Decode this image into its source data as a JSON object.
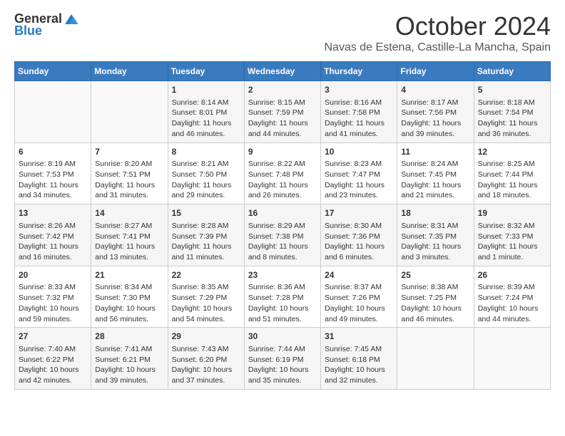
{
  "header": {
    "logo_general": "General",
    "logo_blue": "Blue",
    "month_title": "October 2024",
    "location": "Navas de Estena, Castille-La Mancha, Spain"
  },
  "calendar": {
    "days_of_week": [
      "Sunday",
      "Monday",
      "Tuesday",
      "Wednesday",
      "Thursday",
      "Friday",
      "Saturday"
    ],
    "weeks": [
      [
        {
          "day": "",
          "info": ""
        },
        {
          "day": "",
          "info": ""
        },
        {
          "day": "1",
          "info": "Sunrise: 8:14 AM\nSunset: 8:01 PM\nDaylight: 11 hours and 46 minutes."
        },
        {
          "day": "2",
          "info": "Sunrise: 8:15 AM\nSunset: 7:59 PM\nDaylight: 11 hours and 44 minutes."
        },
        {
          "day": "3",
          "info": "Sunrise: 8:16 AM\nSunset: 7:58 PM\nDaylight: 11 hours and 41 minutes."
        },
        {
          "day": "4",
          "info": "Sunrise: 8:17 AM\nSunset: 7:56 PM\nDaylight: 11 hours and 39 minutes."
        },
        {
          "day": "5",
          "info": "Sunrise: 8:18 AM\nSunset: 7:54 PM\nDaylight: 11 hours and 36 minutes."
        }
      ],
      [
        {
          "day": "6",
          "info": "Sunrise: 8:19 AM\nSunset: 7:53 PM\nDaylight: 11 hours and 34 minutes."
        },
        {
          "day": "7",
          "info": "Sunrise: 8:20 AM\nSunset: 7:51 PM\nDaylight: 11 hours and 31 minutes."
        },
        {
          "day": "8",
          "info": "Sunrise: 8:21 AM\nSunset: 7:50 PM\nDaylight: 11 hours and 29 minutes."
        },
        {
          "day": "9",
          "info": "Sunrise: 8:22 AM\nSunset: 7:48 PM\nDaylight: 11 hours and 26 minutes."
        },
        {
          "day": "10",
          "info": "Sunrise: 8:23 AM\nSunset: 7:47 PM\nDaylight: 11 hours and 23 minutes."
        },
        {
          "day": "11",
          "info": "Sunrise: 8:24 AM\nSunset: 7:45 PM\nDaylight: 11 hours and 21 minutes."
        },
        {
          "day": "12",
          "info": "Sunrise: 8:25 AM\nSunset: 7:44 PM\nDaylight: 11 hours and 18 minutes."
        }
      ],
      [
        {
          "day": "13",
          "info": "Sunrise: 8:26 AM\nSunset: 7:42 PM\nDaylight: 11 hours and 16 minutes."
        },
        {
          "day": "14",
          "info": "Sunrise: 8:27 AM\nSunset: 7:41 PM\nDaylight: 11 hours and 13 minutes."
        },
        {
          "day": "15",
          "info": "Sunrise: 8:28 AM\nSunset: 7:39 PM\nDaylight: 11 hours and 11 minutes."
        },
        {
          "day": "16",
          "info": "Sunrise: 8:29 AM\nSunset: 7:38 PM\nDaylight: 11 hours and 8 minutes."
        },
        {
          "day": "17",
          "info": "Sunrise: 8:30 AM\nSunset: 7:36 PM\nDaylight: 11 hours and 6 minutes."
        },
        {
          "day": "18",
          "info": "Sunrise: 8:31 AM\nSunset: 7:35 PM\nDaylight: 11 hours and 3 minutes."
        },
        {
          "day": "19",
          "info": "Sunrise: 8:32 AM\nSunset: 7:33 PM\nDaylight: 11 hours and 1 minute."
        }
      ],
      [
        {
          "day": "20",
          "info": "Sunrise: 8:33 AM\nSunset: 7:32 PM\nDaylight: 10 hours and 59 minutes."
        },
        {
          "day": "21",
          "info": "Sunrise: 8:34 AM\nSunset: 7:30 PM\nDaylight: 10 hours and 56 minutes."
        },
        {
          "day": "22",
          "info": "Sunrise: 8:35 AM\nSunset: 7:29 PM\nDaylight: 10 hours and 54 minutes."
        },
        {
          "day": "23",
          "info": "Sunrise: 8:36 AM\nSunset: 7:28 PM\nDaylight: 10 hours and 51 minutes."
        },
        {
          "day": "24",
          "info": "Sunrise: 8:37 AM\nSunset: 7:26 PM\nDaylight: 10 hours and 49 minutes."
        },
        {
          "day": "25",
          "info": "Sunrise: 8:38 AM\nSunset: 7:25 PM\nDaylight: 10 hours and 46 minutes."
        },
        {
          "day": "26",
          "info": "Sunrise: 8:39 AM\nSunset: 7:24 PM\nDaylight: 10 hours and 44 minutes."
        }
      ],
      [
        {
          "day": "27",
          "info": "Sunrise: 7:40 AM\nSunset: 6:22 PM\nDaylight: 10 hours and 42 minutes."
        },
        {
          "day": "28",
          "info": "Sunrise: 7:41 AM\nSunset: 6:21 PM\nDaylight: 10 hours and 39 minutes."
        },
        {
          "day": "29",
          "info": "Sunrise: 7:43 AM\nSunset: 6:20 PM\nDaylight: 10 hours and 37 minutes."
        },
        {
          "day": "30",
          "info": "Sunrise: 7:44 AM\nSunset: 6:19 PM\nDaylight: 10 hours and 35 minutes."
        },
        {
          "day": "31",
          "info": "Sunrise: 7:45 AM\nSunset: 6:18 PM\nDaylight: 10 hours and 32 minutes."
        },
        {
          "day": "",
          "info": ""
        },
        {
          "day": "",
          "info": ""
        }
      ]
    ]
  }
}
